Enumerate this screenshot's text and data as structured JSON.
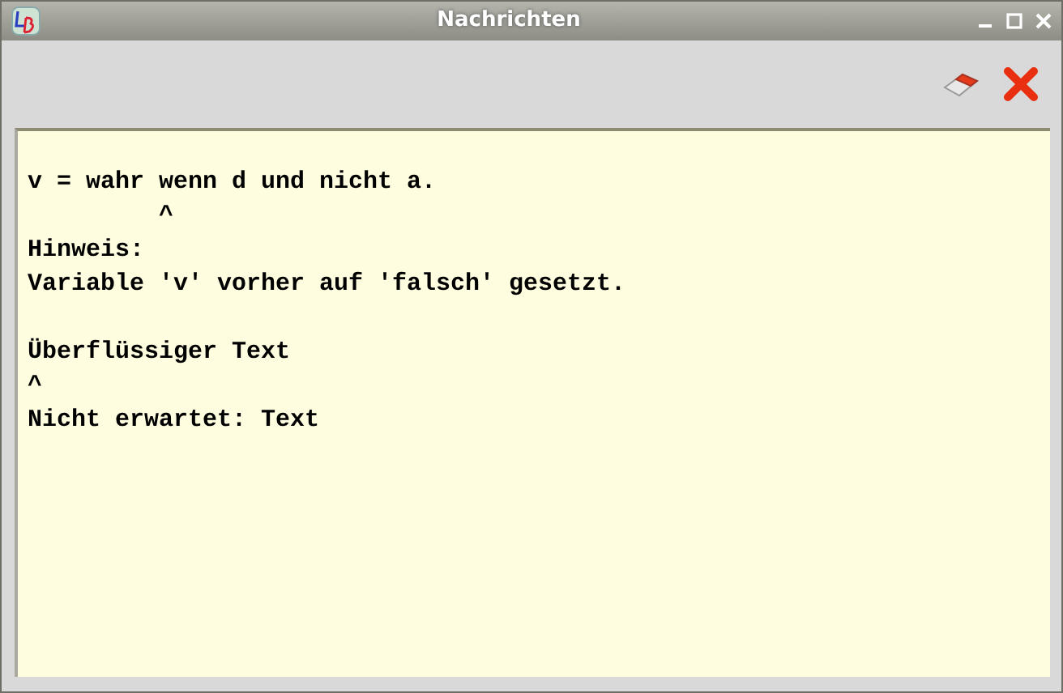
{
  "window": {
    "title": "Nachrichten"
  },
  "messages": [
    {
      "lines": [
        "v = wahr wenn d und nicht a.",
        "         ^",
        "Hinweis:",
        "Variable 'v' vorher auf 'falsch' gesetzt."
      ]
    },
    {
      "lines": [
        "Überflüssiger Text",
        "^",
        "Nicht erwartet: Text"
      ]
    }
  ]
}
